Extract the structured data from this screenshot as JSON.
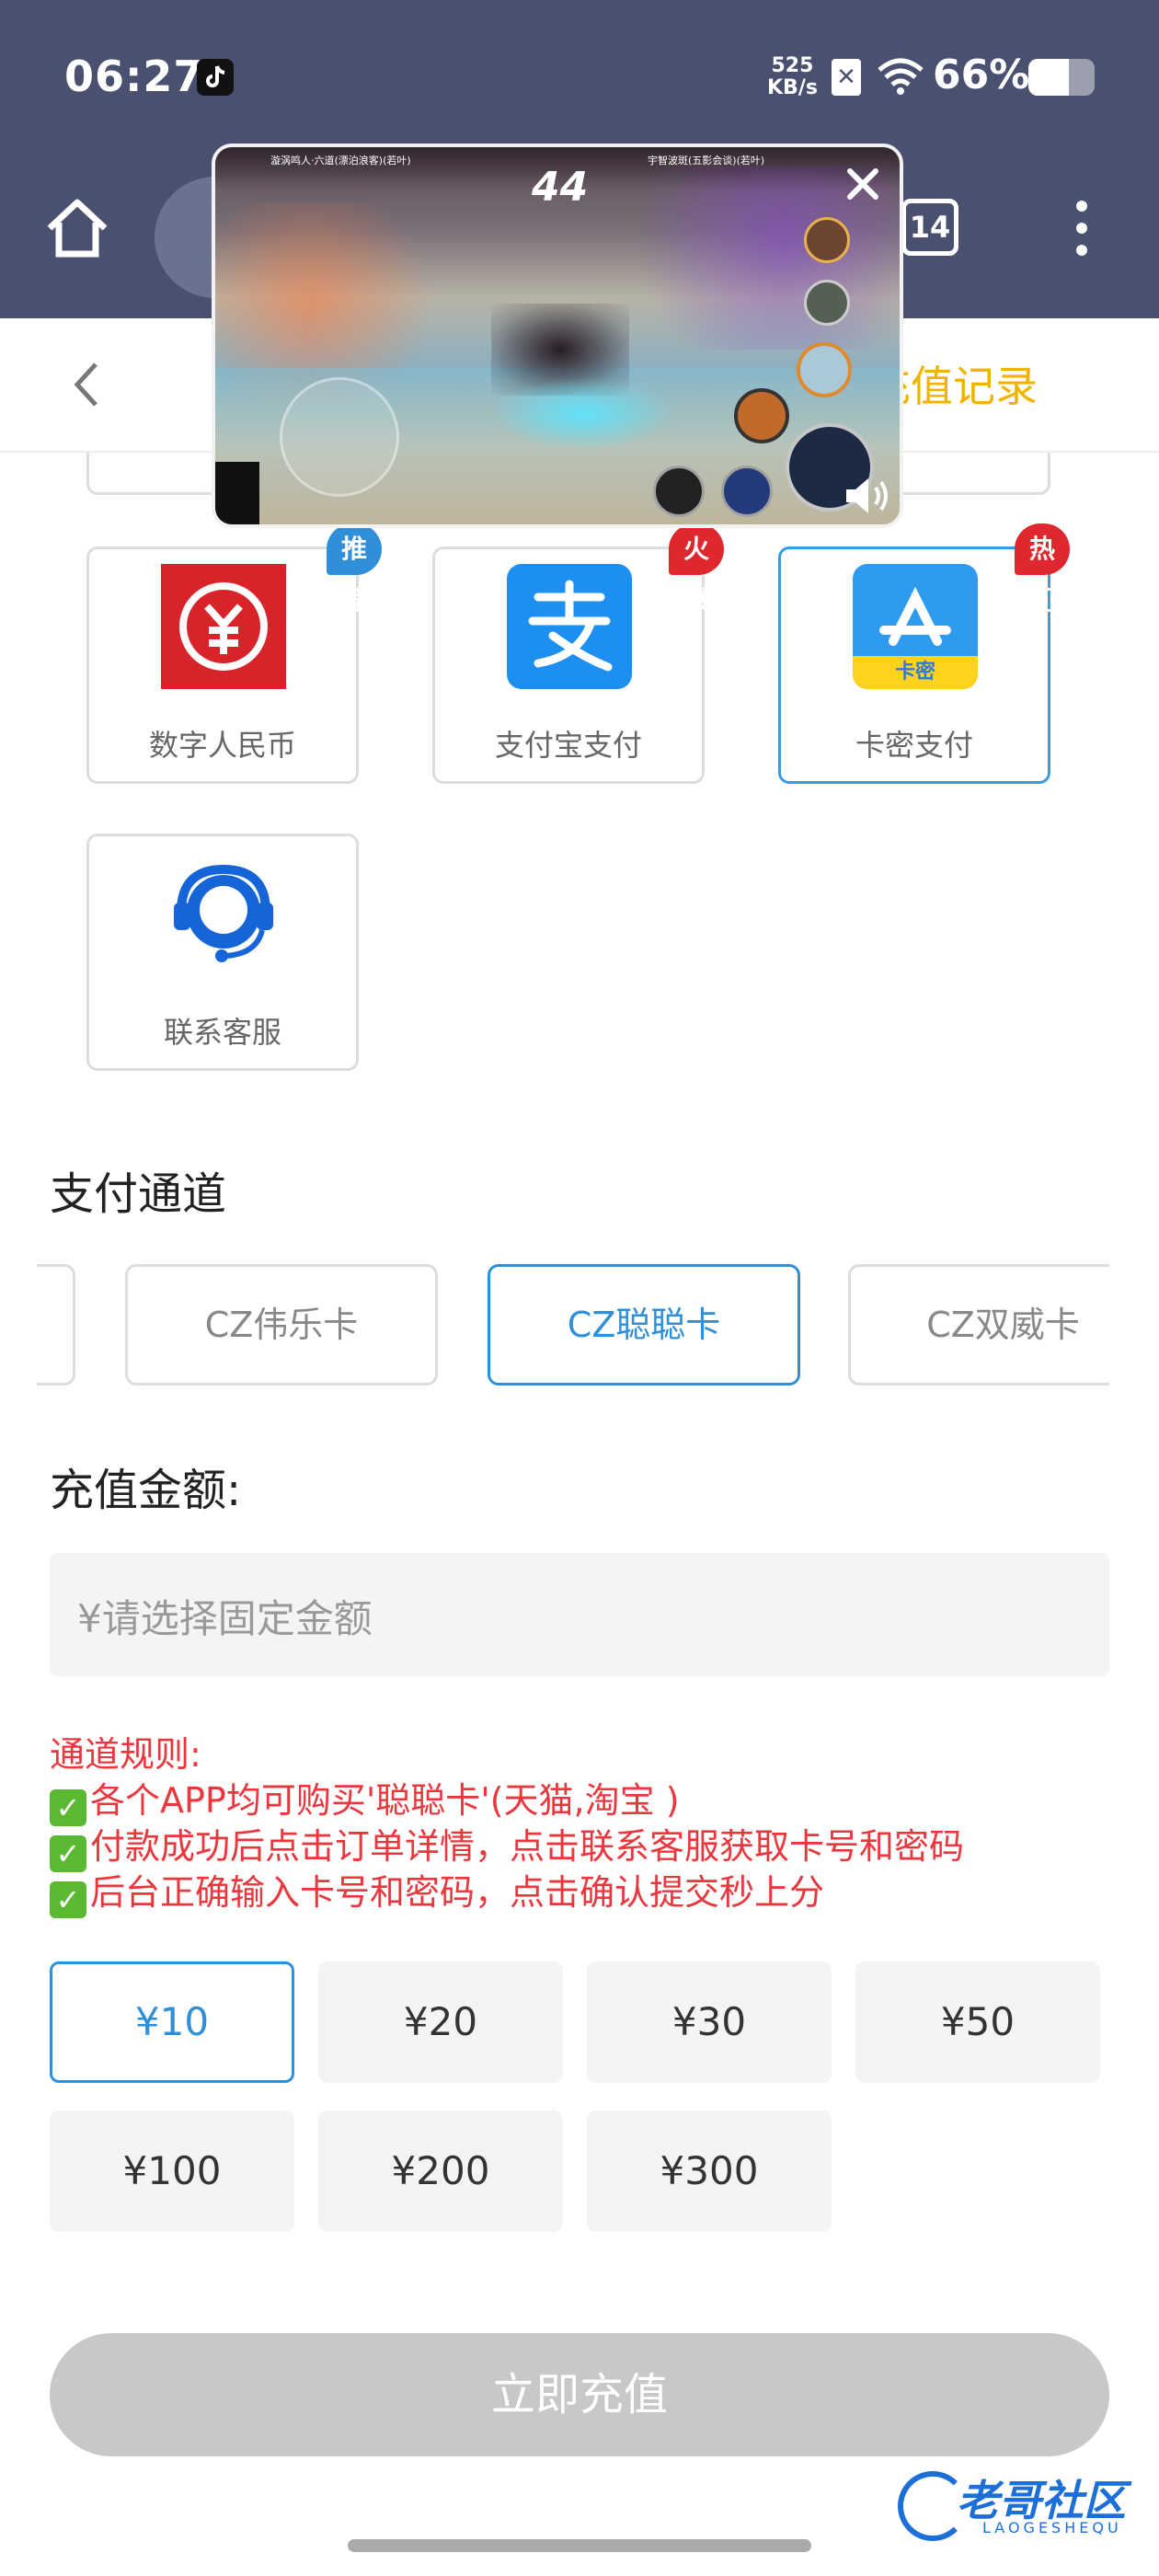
{
  "status": {
    "time": "06:27",
    "speed_value": "525",
    "speed_unit": "KB/s",
    "battery": "66%"
  },
  "browser": {
    "tab_count": "14"
  },
  "header": {
    "right_link": "充值记录"
  },
  "video_overlay": {
    "score": "44",
    "left_team": "漩涡鸣人·六道(漂泊浪客)(若叶)",
    "right_team": "宇智波斑(五影会谈)(若叶)"
  },
  "payment_methods": [
    {
      "label": "数字人民币",
      "badge": "推荐",
      "badge_color": "#2f8fd8"
    },
    {
      "label": "支付宝支付",
      "badge": "火爆",
      "badge_color": "#e0262f"
    },
    {
      "label": "卡密支付",
      "badge": "热门",
      "badge_color": "#e0262f",
      "icon_text": "卡密"
    },
    {
      "label": "联系客服"
    }
  ],
  "channel_section": {
    "title": "支付通道",
    "channels": [
      "CZ伟乐卡",
      "CZ聪聪卡",
      "CZ双威卡"
    ],
    "selected": "CZ聪聪卡"
  },
  "amount_section": {
    "title": "充值金额:",
    "placeholder": "¥请选择固定金额"
  },
  "rules": {
    "title": "通道规则:",
    "lines": [
      "各个APP均可购买'聪聪卡'(天猫,淘宝 )",
      "付款成功后点击订单详情，点击联系客服获取卡号和密码",
      "后台正确输入卡号和密码，点击确认提交秒上分"
    ]
  },
  "amounts": [
    "¥10",
    "¥20",
    "¥30",
    "¥50",
    "¥100",
    "¥200",
    "¥300"
  ],
  "selected_amount": "¥10",
  "submit_label": "立即充值",
  "watermark": {
    "title": "老哥社区",
    "sub": "LAOGESHEQU"
  },
  "colors": {
    "accent": "#2f8fd8",
    "header_link": "#f0b400",
    "rules": "#e8383d",
    "status_bar": "#4a5170"
  }
}
